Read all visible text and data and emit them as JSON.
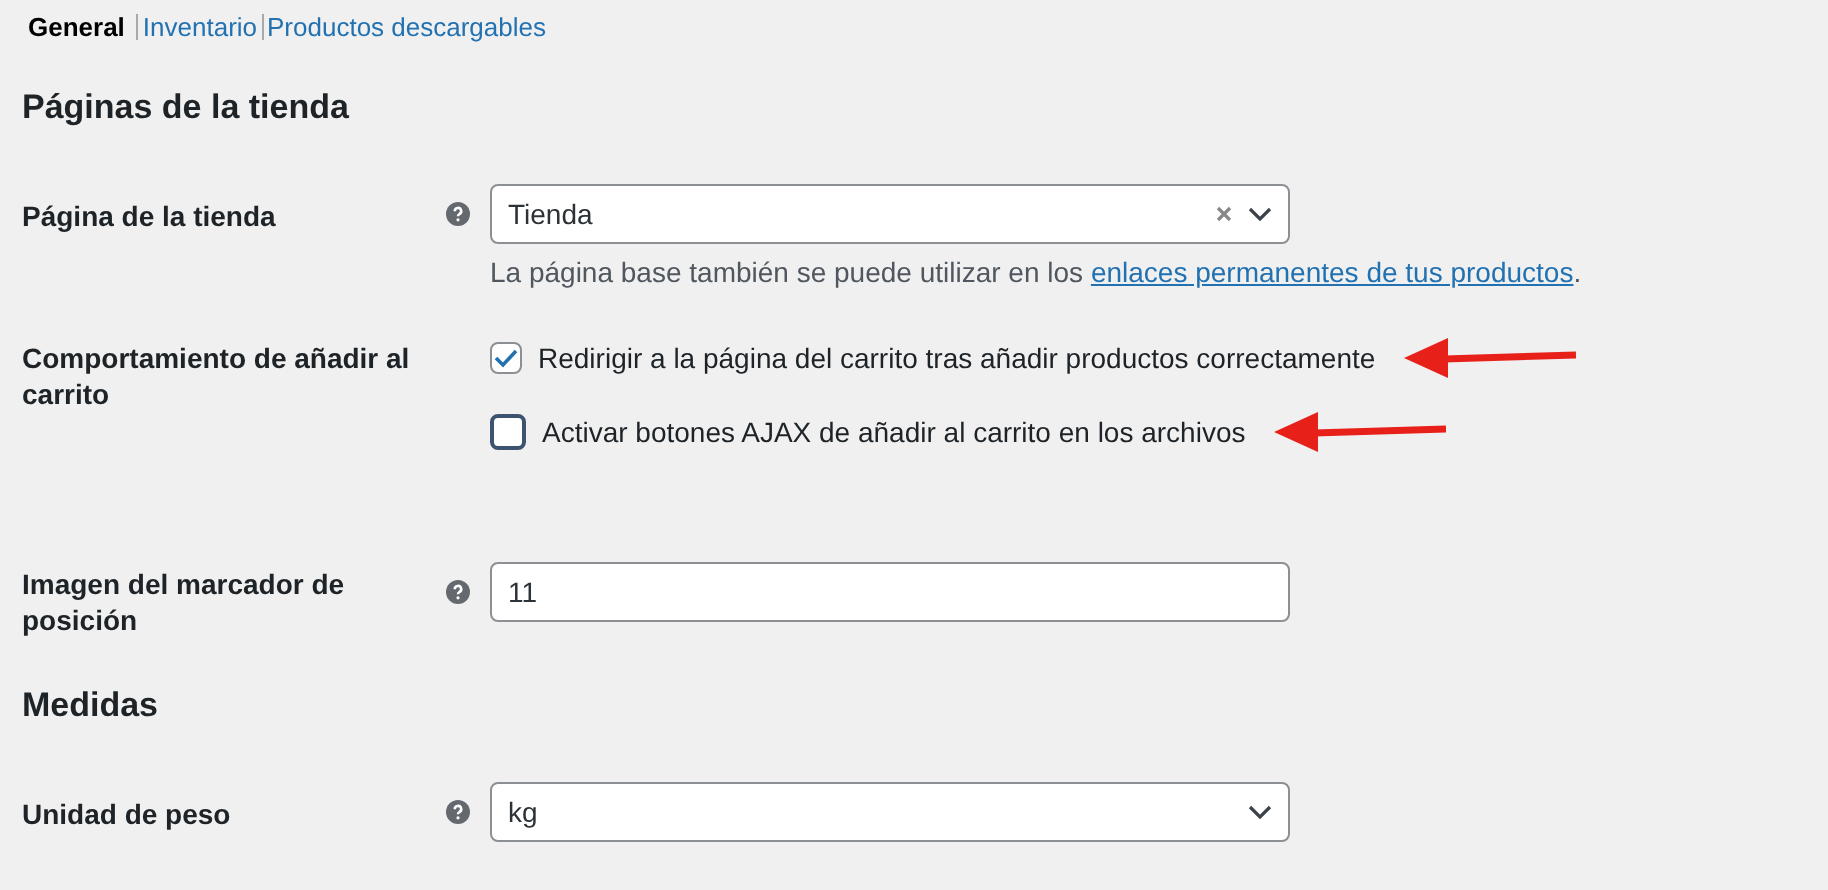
{
  "tabs": [
    {
      "label": "General",
      "selected": true
    },
    {
      "label": "Inventario",
      "selected": false
    },
    {
      "label": "Productos descargables",
      "selected": false
    }
  ],
  "sections": [
    {
      "title": "Páginas de la tienda",
      "rows": [
        {
          "kind": "select",
          "label": "Página de la tienda",
          "help": true,
          "value": "Tienda",
          "clearable": true,
          "description": {
            "text": "La página base también se puede utilizar en los ",
            "link": "enlaces permanentes de tus productos",
            "after": "."
          }
        },
        {
          "kind": "checkboxes",
          "label": "Comportamiento de añadir al carrito",
          "options": [
            {
              "label": "Redirigir a la página del carrito tras añadir productos correctamente",
              "checked": true,
              "highlighted": true
            },
            {
              "label": "Activar botones AJAX de añadir al carrito en los archivos",
              "checked": false,
              "highlighted": true
            }
          ]
        },
        {
          "kind": "text",
          "label": "Imagen del marcador de posición",
          "help": true,
          "value": "11"
        }
      ]
    },
    {
      "title": "Medidas",
      "rows": [
        {
          "kind": "select",
          "label": "Unidad de peso",
          "help": true,
          "value": "kg",
          "clearable": false
        }
      ]
    }
  ]
}
